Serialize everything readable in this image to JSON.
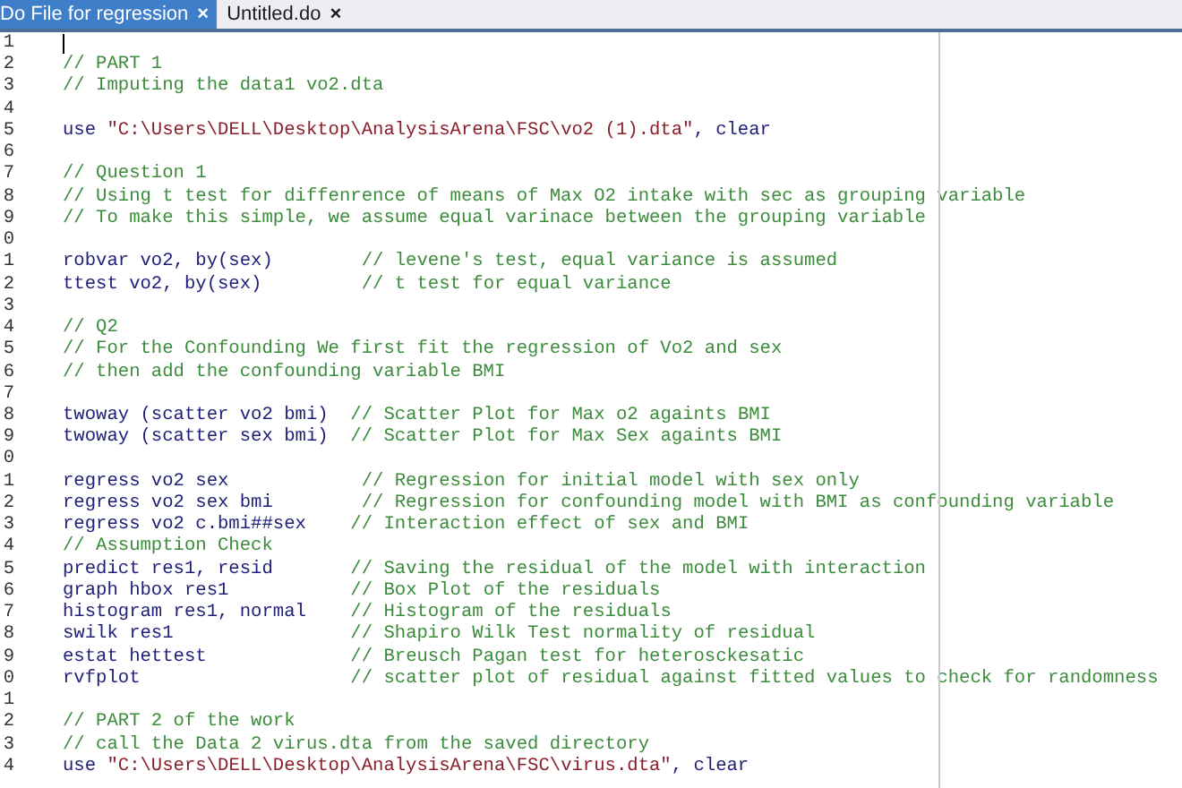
{
  "tabs": [
    {
      "label": "Do File for regression",
      "close": "×",
      "selected": true
    },
    {
      "label": "Untitled.do",
      "close": "×",
      "selected": false
    }
  ],
  "editor": {
    "lines": [
      {
        "number": "1",
        "cursor": true
      },
      {
        "number": "2",
        "cursor": false,
        "segments": [
          {
            "kind": "comment",
            "text": "// PART 1"
          }
        ]
      },
      {
        "number": "3",
        "cursor": false,
        "segments": [
          {
            "kind": "comment",
            "text": "// Imputing the data1 vo2.dta"
          }
        ]
      },
      {
        "number": "4",
        "cursor": false
      },
      {
        "number": "5",
        "cursor": false,
        "segments": [
          {
            "kind": "code",
            "text": "use "
          },
          {
            "kind": "string",
            "text": "\"C:\\Users\\DELL\\Desktop\\AnalysisArena\\FSC\\vo2 (1).dta\""
          },
          {
            "kind": "code",
            "text": ", clear"
          }
        ]
      },
      {
        "number": "6",
        "cursor": false
      },
      {
        "number": "7",
        "cursor": false,
        "segments": [
          {
            "kind": "comment",
            "text": "// Question 1"
          }
        ]
      },
      {
        "number": "8",
        "cursor": false,
        "segments": [
          {
            "kind": "comment",
            "text": "// Using t test for diffenrence of means of Max O2 intake with sec as grouping variable"
          }
        ]
      },
      {
        "number": "9",
        "cursor": false,
        "segments": [
          {
            "kind": "comment",
            "text": "// To make this simple, we assume equal varinace between the grouping variable"
          }
        ]
      },
      {
        "number": "0",
        "cursor": false
      },
      {
        "number": "1",
        "cursor": false,
        "segments": [
          {
            "kind": "code",
            "text": "robvar vo2, by(sex)        "
          },
          {
            "kind": "comment",
            "text": "// levene's test, equal variance is assumed"
          }
        ]
      },
      {
        "number": "2",
        "cursor": false,
        "segments": [
          {
            "kind": "code",
            "text": "ttest vo2, by(sex)         "
          },
          {
            "kind": "comment",
            "text": "// t test for equal variance"
          }
        ]
      },
      {
        "number": "3",
        "cursor": false
      },
      {
        "number": "4",
        "cursor": false,
        "segments": [
          {
            "kind": "comment",
            "text": "// Q2"
          }
        ]
      },
      {
        "number": "5",
        "cursor": false,
        "segments": [
          {
            "kind": "comment",
            "text": "// For the Confounding We first fit the regression of Vo2 and sex"
          }
        ]
      },
      {
        "number": "6",
        "cursor": false,
        "segments": [
          {
            "kind": "comment",
            "text": "// then add the confounding variable BMI"
          }
        ]
      },
      {
        "number": "7",
        "cursor": false
      },
      {
        "number": "8",
        "cursor": false,
        "segments": [
          {
            "kind": "code",
            "text": "twoway (scatter vo2 bmi)  "
          },
          {
            "kind": "comment",
            "text": "// Scatter Plot for Max o2 againts BMI"
          }
        ]
      },
      {
        "number": "9",
        "cursor": false,
        "segments": [
          {
            "kind": "code",
            "text": "twoway (scatter sex bmi)  "
          },
          {
            "kind": "comment",
            "text": "// Scatter Plot for Max Sex againts BMI"
          }
        ]
      },
      {
        "number": "0",
        "cursor": false
      },
      {
        "number": "1",
        "cursor": false,
        "segments": [
          {
            "kind": "code",
            "text": "regress vo2 sex            "
          },
          {
            "kind": "comment",
            "text": "// Regression for initial model with sex only"
          }
        ]
      },
      {
        "number": "2",
        "cursor": false,
        "segments": [
          {
            "kind": "code",
            "text": "regress vo2 sex bmi        "
          },
          {
            "kind": "comment",
            "text": "// Regression for confounding model with BMI as confounding variable"
          }
        ]
      },
      {
        "number": "3",
        "cursor": false,
        "segments": [
          {
            "kind": "code",
            "text": "regress vo2 c.bmi##sex    "
          },
          {
            "kind": "comment",
            "text": "// Interaction effect of sex and BMI"
          }
        ]
      },
      {
        "number": "4",
        "cursor": false,
        "segments": [
          {
            "kind": "comment",
            "text": "// Assumption Check"
          }
        ]
      },
      {
        "number": "5",
        "cursor": false,
        "segments": [
          {
            "kind": "code",
            "text": "predict res1, resid       "
          },
          {
            "kind": "comment",
            "text": "// Saving the residual of the model with interaction"
          }
        ]
      },
      {
        "number": "6",
        "cursor": false,
        "segments": [
          {
            "kind": "code",
            "text": "graph hbox res1           "
          },
          {
            "kind": "comment",
            "text": "// Box Plot of the residuals"
          }
        ]
      },
      {
        "number": "7",
        "cursor": false,
        "segments": [
          {
            "kind": "code",
            "text": "histogram res1, normal    "
          },
          {
            "kind": "comment",
            "text": "// Histogram of the residuals"
          }
        ]
      },
      {
        "number": "8",
        "cursor": false,
        "segments": [
          {
            "kind": "code",
            "text": "swilk res1                "
          },
          {
            "kind": "comment",
            "text": "// Shapiro Wilk Test normality of residual"
          }
        ]
      },
      {
        "number": "9",
        "cursor": false,
        "segments": [
          {
            "kind": "code",
            "text": "estat hettest             "
          },
          {
            "kind": "comment",
            "text": "// Breusch Pagan test for heterosckesatic"
          }
        ]
      },
      {
        "number": "0",
        "cursor": false,
        "segments": [
          {
            "kind": "code",
            "text": "rvfplot                   "
          },
          {
            "kind": "comment",
            "text": "// scatter plot of residual against fitted values to check for randomness"
          }
        ]
      },
      {
        "number": "1",
        "cursor": false
      },
      {
        "number": "2",
        "cursor": false,
        "segments": [
          {
            "kind": "comment",
            "text": "// PART 2 of the work"
          }
        ]
      },
      {
        "number": "3",
        "cursor": false,
        "segments": [
          {
            "kind": "comment",
            "text": "// call the Data 2 virus.dta from the saved directory"
          }
        ]
      },
      {
        "number": "4",
        "cursor": false,
        "segments": [
          {
            "kind": "code",
            "text": "use "
          },
          {
            "kind": "string",
            "text": "\"C:\\Users\\DELL\\Desktop\\AnalysisArena\\FSC\\virus.dta\""
          },
          {
            "kind": "code",
            "text": ", clear"
          }
        ]
      }
    ]
  }
}
